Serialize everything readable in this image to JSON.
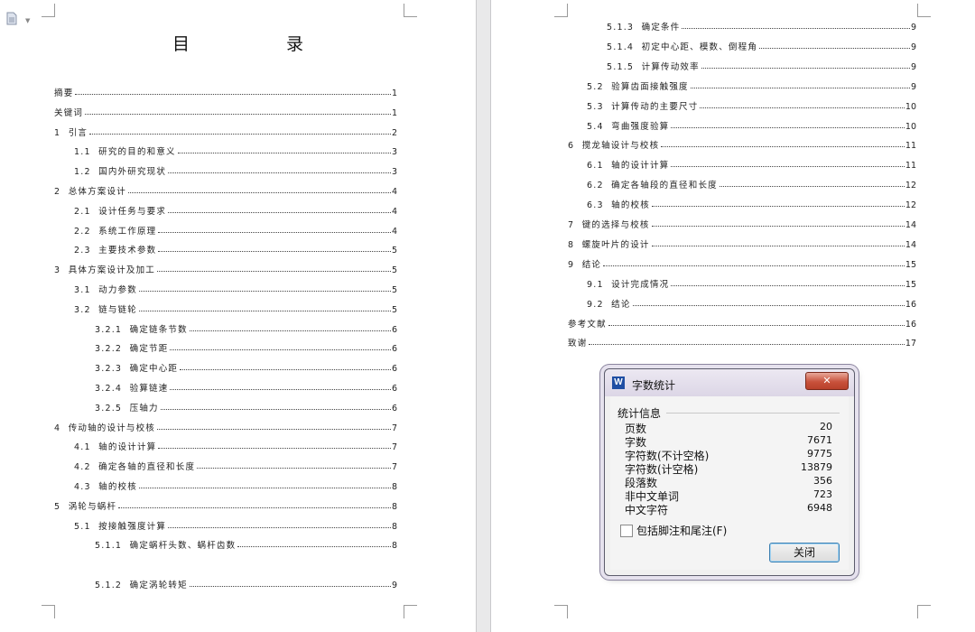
{
  "left_page": {
    "title": "目　录",
    "entries": [
      {
        "num": "",
        "text": "摘要 ",
        "page": "1"
      },
      {
        "num": "",
        "text": "关键词 ",
        "page": "1"
      },
      {
        "num": "1  ",
        "text": "引言",
        "page": "2"
      },
      {
        "num": "1.1  ",
        "text": "研究的目的和意义",
        "page": "3"
      },
      {
        "num": "1.2  ",
        "text": "国内外研究现状",
        "page": "3"
      },
      {
        "num": "2  ",
        "text": "总体方案设计",
        "page": "4"
      },
      {
        "num": "2.1  ",
        "text": "设计任务与要求",
        "page": "4"
      },
      {
        "num": "2.2  ",
        "text": "系统工作原理",
        "page": "4"
      },
      {
        "num": "2.3  ",
        "text": "主要技术参数",
        "page": "5"
      },
      {
        "num": "3  ",
        "text": "具体方案设计及加工",
        "page": "5"
      },
      {
        "num": "3.1  ",
        "text": "动力参数",
        "page": "5"
      },
      {
        "num": "3.2  ",
        "text": "链与链轮",
        "page": "5"
      },
      {
        "num": "3.2.1  ",
        "text": "确定链条节数",
        "page": "6"
      },
      {
        "num": "3.2.2  ",
        "text": "确定节距",
        "page": "6"
      },
      {
        "num": "3.2.3  ",
        "text": "确定中心距",
        "page": "6"
      },
      {
        "num": "3.2.4  ",
        "text": "验算链速",
        "page": "6"
      },
      {
        "num": "3.2.5  ",
        "text": "压轴力",
        "page": "6"
      },
      {
        "num": "4  ",
        "text": "传动轴的设计与校核",
        "page": "7"
      },
      {
        "num": "4.1  ",
        "text": "轴的设计计算",
        "page": "7"
      },
      {
        "num": "4.2  ",
        "text": "确定各轴的直径和长度",
        "page": "7"
      },
      {
        "num": "4.3  ",
        "text": "轴的校核",
        "page": "8"
      },
      {
        "num": "5  ",
        "text": "涡轮与蜗杆",
        "page": "8"
      },
      {
        "num": "5.1  ",
        "text": "按接触强度计算",
        "page": "8"
      },
      {
        "num": "5.1.1  ",
        "text": "确定蜗杆头数、蜗杆齿数",
        "page": "8"
      },
      {
        "num": "5.1.2  ",
        "text": "确定涡轮转矩",
        "page": "9"
      }
    ]
  },
  "right_page": {
    "entries": [
      {
        "num": "5.1.3  ",
        "text": "确定条件",
        "page": "9"
      },
      {
        "num": "5.1.4  ",
        "text": "初定中心距、模数、倒程角",
        "page": "9"
      },
      {
        "num": "5.1.5  ",
        "text": "计算传动效率",
        "page": "9"
      },
      {
        "num": "5.2  ",
        "text": "验算齿面接触强度",
        "page": "9"
      },
      {
        "num": "5.3  ",
        "text": "计算传动的主要尺寸",
        "page": "10"
      },
      {
        "num": "5.4  ",
        "text": "弯曲强度验算",
        "page": "10"
      },
      {
        "num": "6  ",
        "text": "搅龙轴设计与校核",
        "page": "11"
      },
      {
        "num": "6.1  ",
        "text": "轴的设计计算",
        "page": "11"
      },
      {
        "num": "6.2  ",
        "text": "确定各轴段的直径和长度",
        "page": "12"
      },
      {
        "num": "6.3  ",
        "text": "轴的校核",
        "page": "12"
      },
      {
        "num": "7  ",
        "text": "键的选择与校核",
        "page": "14"
      },
      {
        "num": "8  ",
        "text": "螺旋叶片的设计",
        "page": "14"
      },
      {
        "num": "9  ",
        "text": "结论 ",
        "page": "15"
      },
      {
        "num": "9.1  ",
        "text": "设计完成情况",
        "page": "15"
      },
      {
        "num": "9.2  ",
        "text": "结论",
        "page": "16"
      },
      {
        "num": "",
        "text": "参考文献 ",
        "page": "16"
      },
      {
        "num": "",
        "text": "致谢 ",
        "page": "17"
      }
    ]
  },
  "dialog": {
    "title": "字数统计",
    "app_icon_letter": "W",
    "close_glyph": "✕",
    "group_label": "统计信息",
    "stats": [
      {
        "label": "页数",
        "value": "20"
      },
      {
        "label": "字数",
        "value": "7671"
      },
      {
        "label": "字符数(不计空格)",
        "value": "9775"
      },
      {
        "label": "字符数(计空格)",
        "value": "13879"
      },
      {
        "label": "段落数",
        "value": "356"
      },
      {
        "label": "非中文单词",
        "value": "723"
      },
      {
        "label": "中文字符",
        "value": "6948"
      }
    ],
    "checkbox_label": "包括脚注和尾注(F)",
    "checkbox_checked": false,
    "close_button_label": "关闭"
  },
  "colors": {
    "dialog_close_red": "#c8523c",
    "app_icon_blue": "#1f4ea3",
    "page_gap": "#e9e9ea"
  },
  "icons": [
    "document-icon",
    "dropdown-caret-icon",
    "app-icon",
    "close-icon",
    "checkbox-icon"
  ]
}
